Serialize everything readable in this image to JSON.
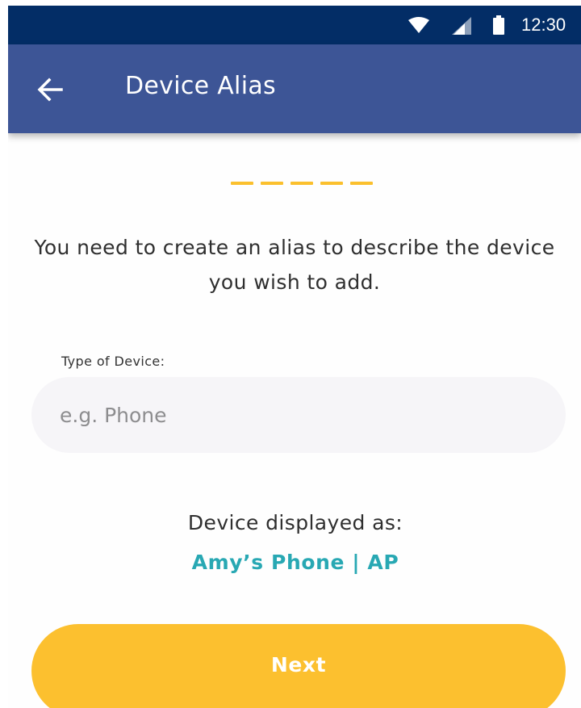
{
  "status_bar": {
    "time": "12:30",
    "icons": [
      "wifi-icon",
      "signal-icon",
      "battery-icon"
    ],
    "background_color": "#032d66"
  },
  "app_bar": {
    "title": "Device Alias",
    "back_icon": "arrow-left-icon",
    "background_color": "#3d5596"
  },
  "progress": {
    "steps": 5,
    "color": "#fbc02d"
  },
  "instruction": "You need to create an alias to describe the device you wish to add.",
  "device_field": {
    "label": "Type of Device:",
    "value": "",
    "placeholder": "e.g. Phone"
  },
  "preview": {
    "label": "Device displayed as:",
    "value": "Amy’s Phone | AP",
    "color": "#28a8b3"
  },
  "next_button": {
    "label": "Next",
    "color": "#fcc02f"
  }
}
